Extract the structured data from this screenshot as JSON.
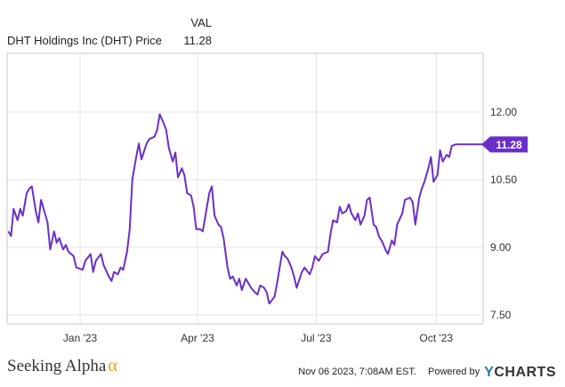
{
  "legend": {
    "column_header": "VAL",
    "series_name": "DHT Holdings Inc (DHT) Price",
    "series_value": "11.28"
  },
  "chart_data": {
    "type": "line",
    "x_tick_labels": [
      "Jan '23",
      "Apr '23",
      "Jul '23",
      "Oct '23"
    ],
    "x_tick_dates": [
      "2023-01-01",
      "2023-04-01",
      "2023-07-01",
      "2023-10-01"
    ],
    "xlim": [
      "2022-11-06",
      "2023-11-06"
    ],
    "y_tick_labels": [
      "7.50",
      "9.00",
      "10.50",
      "12.00"
    ],
    "y_ticks": [
      7.5,
      9.0,
      10.5,
      12.0
    ],
    "ylim": [
      7.3,
      13.3
    ],
    "grid": {
      "horizontal": true,
      "vertical": true
    },
    "last_value_label": "11.28",
    "colors": {
      "line": "#6b2fc9",
      "grid": "#e4e4e4",
      "frame": "#c8c8c8"
    },
    "series": [
      {
        "name": "DHT Holdings Inc (DHT) Price",
        "x": [
          "2022-11-07",
          "2022-11-09",
          "2022-11-11",
          "2022-11-14",
          "2022-11-16",
          "2022-11-18",
          "2022-11-21",
          "2022-11-23",
          "2022-11-25",
          "2022-11-28",
          "2022-11-30",
          "2022-12-02",
          "2022-12-05",
          "2022-12-07",
          "2022-12-09",
          "2022-12-12",
          "2022-12-14",
          "2022-12-16",
          "2022-12-19",
          "2022-12-21",
          "2022-12-23",
          "2022-12-27",
          "2022-12-29",
          "2023-01-03",
          "2023-01-05",
          "2023-01-09",
          "2023-01-11",
          "2023-01-13",
          "2023-01-17",
          "2023-01-19",
          "2023-01-23",
          "2023-01-25",
          "2023-01-27",
          "2023-01-30",
          "2023-02-01",
          "2023-02-03",
          "2023-02-06",
          "2023-02-08",
          "2023-02-10",
          "2023-02-13",
          "2023-02-15",
          "2023-02-17",
          "2023-02-21",
          "2023-02-23",
          "2023-02-27",
          "2023-03-01",
          "2023-03-03",
          "2023-03-06",
          "2023-03-08",
          "2023-03-10",
          "2023-03-13",
          "2023-03-15",
          "2023-03-17",
          "2023-03-20",
          "2023-03-22",
          "2023-03-24",
          "2023-03-27",
          "2023-03-29",
          "2023-03-31",
          "2023-04-03",
          "2023-04-05",
          "2023-04-10",
          "2023-04-12",
          "2023-04-14",
          "2023-04-17",
          "2023-04-19",
          "2023-04-21",
          "2023-04-24",
          "2023-04-26",
          "2023-04-28",
          "2023-05-01",
          "2023-05-03",
          "2023-05-05",
          "2023-05-08",
          "2023-05-10",
          "2023-05-12",
          "2023-05-15",
          "2023-05-17",
          "2023-05-19",
          "2023-05-22",
          "2023-05-24",
          "2023-05-26",
          "2023-05-30",
          "2023-06-01",
          "2023-06-05",
          "2023-06-07",
          "2023-06-09",
          "2023-06-12",
          "2023-06-14",
          "2023-06-16",
          "2023-06-20",
          "2023-06-22",
          "2023-06-26",
          "2023-06-28",
          "2023-06-30",
          "2023-07-03",
          "2023-07-06",
          "2023-07-10",
          "2023-07-12",
          "2023-07-14",
          "2023-07-17",
          "2023-07-19",
          "2023-07-21",
          "2023-07-24",
          "2023-07-26",
          "2023-07-28",
          "2023-07-31",
          "2023-08-02",
          "2023-08-04",
          "2023-08-07",
          "2023-08-09",
          "2023-08-11",
          "2023-08-14",
          "2023-08-16",
          "2023-08-18",
          "2023-08-21",
          "2023-08-23",
          "2023-08-25",
          "2023-08-28",
          "2023-08-30",
          "2023-09-01",
          "2023-09-05",
          "2023-09-07",
          "2023-09-11",
          "2023-09-13",
          "2023-09-15",
          "2023-09-18",
          "2023-09-20",
          "2023-09-22",
          "2023-09-25",
          "2023-09-27",
          "2023-09-29",
          "2023-10-02",
          "2023-10-04",
          "2023-10-06",
          "2023-10-09",
          "2023-10-11",
          "2023-10-13",
          "2023-10-16",
          "2023-10-18",
          "2023-10-20",
          "2023-10-23",
          "2023-10-25",
          "2023-10-27",
          "2023-10-30",
          "2023-11-01",
          "2023-11-03",
          "2023-11-06"
        ],
        "y": [
          9.35,
          9.25,
          9.85,
          9.6,
          9.85,
          9.7,
          10.2,
          10.3,
          10.35,
          9.8,
          9.55,
          10.05,
          9.75,
          9.55,
          8.95,
          9.35,
          9.1,
          9.2,
          8.95,
          9.05,
          8.9,
          8.8,
          8.55,
          8.5,
          8.7,
          8.85,
          8.45,
          8.7,
          8.85,
          8.6,
          8.35,
          8.25,
          8.45,
          8.4,
          8.55,
          8.5,
          8.9,
          9.4,
          10.5,
          11.0,
          11.3,
          10.95,
          11.3,
          11.4,
          11.45,
          11.6,
          11.95,
          11.75,
          11.6,
          11.2,
          10.9,
          11.1,
          10.55,
          10.75,
          10.6,
          10.2,
          10.15,
          9.9,
          9.4,
          9.4,
          9.35,
          10.2,
          10.35,
          9.7,
          9.5,
          9.45,
          9.2,
          8.55,
          8.3,
          8.35,
          8.15,
          8.3,
          8.05,
          8.3,
          8.2,
          8.1,
          8.0,
          7.95,
          8.15,
          8.1,
          8.0,
          7.75,
          7.9,
          8.2,
          8.9,
          8.8,
          8.75,
          8.55,
          8.35,
          8.1,
          8.45,
          8.55,
          8.4,
          8.55,
          8.8,
          8.7,
          8.85,
          8.9,
          9.3,
          9.6,
          9.55,
          9.9,
          9.75,
          9.8,
          9.95,
          9.75,
          9.6,
          9.75,
          9.5,
          9.7,
          10.05,
          10.1,
          9.5,
          9.45,
          9.25,
          9.1,
          8.95,
          8.85,
          9.15,
          9.05,
          9.5,
          9.75,
          10.05,
          10.1,
          10.0,
          9.5,
          10.1,
          10.3,
          10.45,
          10.75,
          11.0,
          10.45,
          10.6,
          11.15,
          10.9,
          11.05,
          11.0,
          11.25,
          11.28,
          11.28,
          11.28,
          11.28,
          11.28,
          11.28,
          11.28,
          11.28,
          11.28,
          11.28
        ]
      }
    ]
  },
  "footer": {
    "brand": "Seeking Alpha",
    "alpha_glyph": "α",
    "timestamp": "Nov 06 2023, 7:08AM EST.",
    "powered_by": "Powered by",
    "ycharts_y": "Y",
    "ycharts_rest": "CHARTS"
  }
}
